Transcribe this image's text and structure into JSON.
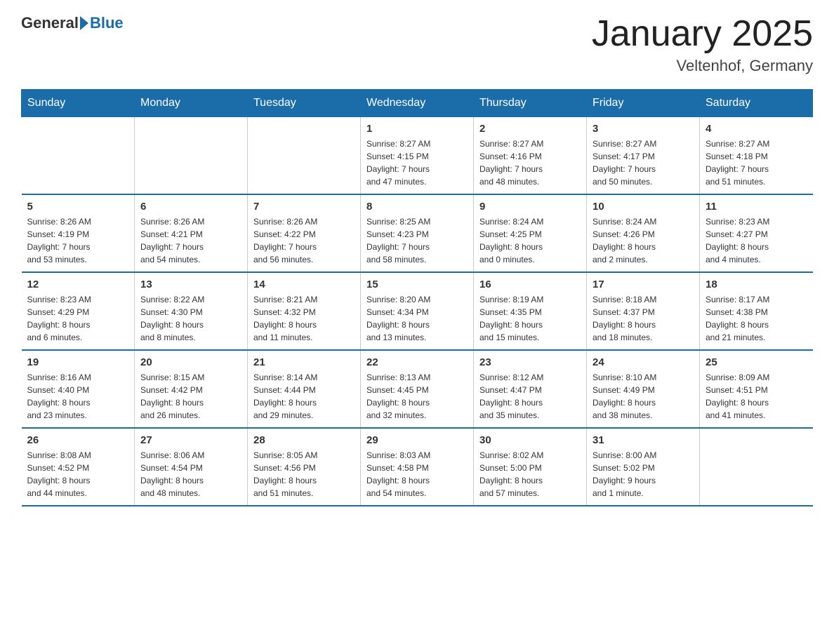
{
  "header": {
    "logo_general": "General",
    "logo_blue": "Blue",
    "month_title": "January 2025",
    "location": "Veltenhof, Germany"
  },
  "days_of_week": [
    "Sunday",
    "Monday",
    "Tuesday",
    "Wednesday",
    "Thursday",
    "Friday",
    "Saturday"
  ],
  "weeks": [
    [
      {
        "day": "",
        "info": ""
      },
      {
        "day": "",
        "info": ""
      },
      {
        "day": "",
        "info": ""
      },
      {
        "day": "1",
        "info": "Sunrise: 8:27 AM\nSunset: 4:15 PM\nDaylight: 7 hours\nand 47 minutes."
      },
      {
        "day": "2",
        "info": "Sunrise: 8:27 AM\nSunset: 4:16 PM\nDaylight: 7 hours\nand 48 minutes."
      },
      {
        "day": "3",
        "info": "Sunrise: 8:27 AM\nSunset: 4:17 PM\nDaylight: 7 hours\nand 50 minutes."
      },
      {
        "day": "4",
        "info": "Sunrise: 8:27 AM\nSunset: 4:18 PM\nDaylight: 7 hours\nand 51 minutes."
      }
    ],
    [
      {
        "day": "5",
        "info": "Sunrise: 8:26 AM\nSunset: 4:19 PM\nDaylight: 7 hours\nand 53 minutes."
      },
      {
        "day": "6",
        "info": "Sunrise: 8:26 AM\nSunset: 4:21 PM\nDaylight: 7 hours\nand 54 minutes."
      },
      {
        "day": "7",
        "info": "Sunrise: 8:26 AM\nSunset: 4:22 PM\nDaylight: 7 hours\nand 56 minutes."
      },
      {
        "day": "8",
        "info": "Sunrise: 8:25 AM\nSunset: 4:23 PM\nDaylight: 7 hours\nand 58 minutes."
      },
      {
        "day": "9",
        "info": "Sunrise: 8:24 AM\nSunset: 4:25 PM\nDaylight: 8 hours\nand 0 minutes."
      },
      {
        "day": "10",
        "info": "Sunrise: 8:24 AM\nSunset: 4:26 PM\nDaylight: 8 hours\nand 2 minutes."
      },
      {
        "day": "11",
        "info": "Sunrise: 8:23 AM\nSunset: 4:27 PM\nDaylight: 8 hours\nand 4 minutes."
      }
    ],
    [
      {
        "day": "12",
        "info": "Sunrise: 8:23 AM\nSunset: 4:29 PM\nDaylight: 8 hours\nand 6 minutes."
      },
      {
        "day": "13",
        "info": "Sunrise: 8:22 AM\nSunset: 4:30 PM\nDaylight: 8 hours\nand 8 minutes."
      },
      {
        "day": "14",
        "info": "Sunrise: 8:21 AM\nSunset: 4:32 PM\nDaylight: 8 hours\nand 11 minutes."
      },
      {
        "day": "15",
        "info": "Sunrise: 8:20 AM\nSunset: 4:34 PM\nDaylight: 8 hours\nand 13 minutes."
      },
      {
        "day": "16",
        "info": "Sunrise: 8:19 AM\nSunset: 4:35 PM\nDaylight: 8 hours\nand 15 minutes."
      },
      {
        "day": "17",
        "info": "Sunrise: 8:18 AM\nSunset: 4:37 PM\nDaylight: 8 hours\nand 18 minutes."
      },
      {
        "day": "18",
        "info": "Sunrise: 8:17 AM\nSunset: 4:38 PM\nDaylight: 8 hours\nand 21 minutes."
      }
    ],
    [
      {
        "day": "19",
        "info": "Sunrise: 8:16 AM\nSunset: 4:40 PM\nDaylight: 8 hours\nand 23 minutes."
      },
      {
        "day": "20",
        "info": "Sunrise: 8:15 AM\nSunset: 4:42 PM\nDaylight: 8 hours\nand 26 minutes."
      },
      {
        "day": "21",
        "info": "Sunrise: 8:14 AM\nSunset: 4:44 PM\nDaylight: 8 hours\nand 29 minutes."
      },
      {
        "day": "22",
        "info": "Sunrise: 8:13 AM\nSunset: 4:45 PM\nDaylight: 8 hours\nand 32 minutes."
      },
      {
        "day": "23",
        "info": "Sunrise: 8:12 AM\nSunset: 4:47 PM\nDaylight: 8 hours\nand 35 minutes."
      },
      {
        "day": "24",
        "info": "Sunrise: 8:10 AM\nSunset: 4:49 PM\nDaylight: 8 hours\nand 38 minutes."
      },
      {
        "day": "25",
        "info": "Sunrise: 8:09 AM\nSunset: 4:51 PM\nDaylight: 8 hours\nand 41 minutes."
      }
    ],
    [
      {
        "day": "26",
        "info": "Sunrise: 8:08 AM\nSunset: 4:52 PM\nDaylight: 8 hours\nand 44 minutes."
      },
      {
        "day": "27",
        "info": "Sunrise: 8:06 AM\nSunset: 4:54 PM\nDaylight: 8 hours\nand 48 minutes."
      },
      {
        "day": "28",
        "info": "Sunrise: 8:05 AM\nSunset: 4:56 PM\nDaylight: 8 hours\nand 51 minutes."
      },
      {
        "day": "29",
        "info": "Sunrise: 8:03 AM\nSunset: 4:58 PM\nDaylight: 8 hours\nand 54 minutes."
      },
      {
        "day": "30",
        "info": "Sunrise: 8:02 AM\nSunset: 5:00 PM\nDaylight: 8 hours\nand 57 minutes."
      },
      {
        "day": "31",
        "info": "Sunrise: 8:00 AM\nSunset: 5:02 PM\nDaylight: 9 hours\nand 1 minute."
      },
      {
        "day": "",
        "info": ""
      }
    ]
  ]
}
